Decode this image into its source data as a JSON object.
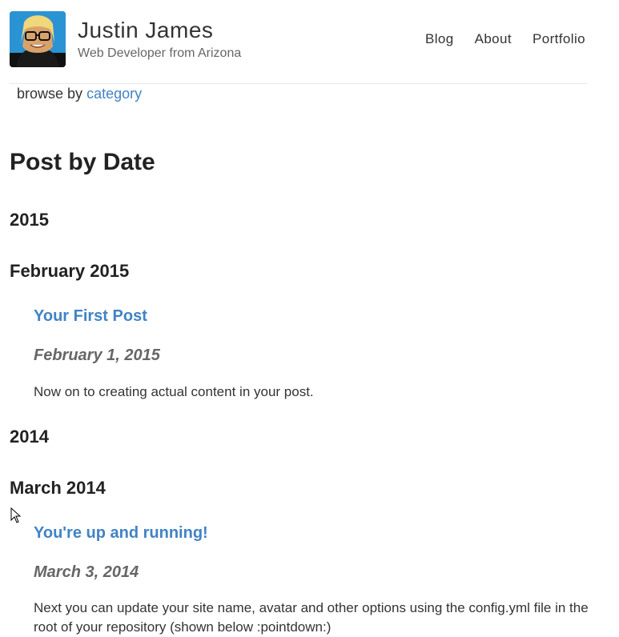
{
  "header": {
    "site_title": "Justin James",
    "tagline": "Web Developer from Arizona",
    "avatar_icon": "avatar-photo",
    "nav": [
      {
        "label": "Blog"
      },
      {
        "label": "About"
      },
      {
        "label": "Portfolio"
      }
    ]
  },
  "browse": {
    "prefix": "browse by",
    "link_label": "category"
  },
  "main": {
    "page_title": "Post by Date",
    "years": [
      {
        "year": "2015",
        "months": [
          {
            "month": "February 2015",
            "posts": [
              {
                "title": "Your First Post",
                "date": "February 1, 2015",
                "excerpt": "Now on to creating actual content in your post."
              }
            ]
          }
        ]
      },
      {
        "year": "2014",
        "months": [
          {
            "month": "March 2014",
            "posts": [
              {
                "title": "You're up and running!",
                "date": "March 3, 2014",
                "excerpt": "Next you can update your site name, avatar and other options using the config.yml file in the root of your repository (shown below :pointdown:)"
              }
            ]
          }
        ]
      }
    ]
  },
  "colors": {
    "link": "#4183c4",
    "date": "#666666",
    "text": "#222222"
  }
}
